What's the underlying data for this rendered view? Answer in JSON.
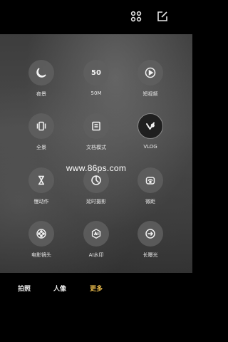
{
  "top_icons": [
    "grid-icon",
    "edit-icon"
  ],
  "modes": [
    {
      "label": "夜景",
      "icon": "moon-icon"
    },
    {
      "label": "50M",
      "icon_text": "50"
    },
    {
      "label": "短视频",
      "icon": "play-icon"
    },
    {
      "label": "全景",
      "icon": "panorama-icon"
    },
    {
      "label": "文档模式",
      "icon": "document-icon"
    },
    {
      "label": "VLOG",
      "icon": "vlog-icon"
    },
    {
      "label": "慢动作",
      "icon": "hourglass-icon"
    },
    {
      "label": "延时摄影",
      "icon": "timelapse-icon"
    },
    {
      "label": "微距",
      "icon": "macro-icon"
    },
    {
      "label": "电影镜头",
      "icon": "film-reel-icon"
    },
    {
      "label": "AI水印",
      "icon": "ai-watermark-icon"
    },
    {
      "label": "长曝光",
      "icon": "long-exposure-icon"
    }
  ],
  "watermark": "www.86ps.com",
  "tabs": {
    "photo": "拍照",
    "portrait": "人像",
    "more": "更多"
  },
  "colors": {
    "active_tab": "#e7b94b",
    "background": "#000000"
  }
}
